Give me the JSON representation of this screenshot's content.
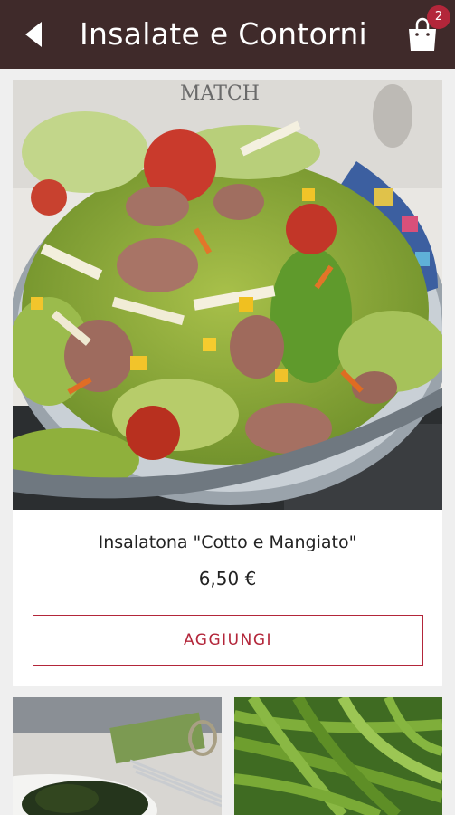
{
  "header": {
    "title": "Insalate e Contorni",
    "cart_count": "2",
    "icons": {
      "back": "back-arrow-icon",
      "cart": "shopping-bag-icon"
    }
  },
  "product": {
    "name": "Insalatona \"Cotto e Mangiato\"",
    "price": "6,50 €",
    "add_label": "AGGIUNGI",
    "image_overlay_text": "MATCH"
  },
  "colors": {
    "header_bg": "#3f2a2a",
    "accent": "#b3263a",
    "page_bg": "#efefef",
    "card_bg": "#ffffff"
  },
  "next_items": [
    {
      "image": "spinach-dish-photo"
    },
    {
      "image": "green-beans-photo"
    }
  ]
}
